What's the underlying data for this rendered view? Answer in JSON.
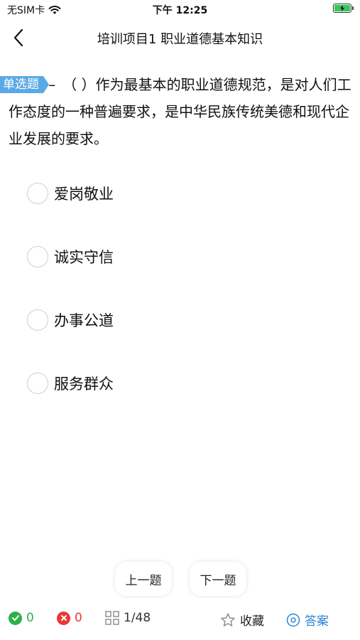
{
  "status_bar": {
    "carrier": "无SIM卡",
    "time": "下午 12:25"
  },
  "nav": {
    "title": "培训项目1 职业道德基本知识"
  },
  "question": {
    "type_tag": "单选题",
    "text": "-–　（ ）作为最基本的职业道德规范，是对人们工作态度的一种普遍要求，是中华民族传统美德和现代企业发展的要求。"
  },
  "options": [
    {
      "label": "爱岗敬业"
    },
    {
      "label": "诚实守信"
    },
    {
      "label": "办事公道"
    },
    {
      "label": "服务群众"
    }
  ],
  "buttons": {
    "prev": "上一题",
    "next": "下一题"
  },
  "bottom_bar": {
    "correct_count": "0",
    "wrong_count": "0",
    "progress": "1/48",
    "favorite": "收藏",
    "answer": "答案"
  },
  "colors": {
    "tag_blue": "#5aa9e6",
    "correct_green": "#2db14a",
    "wrong_red": "#e53935",
    "answer_blue": "#2f86d6",
    "battery_green": "#34c759"
  }
}
